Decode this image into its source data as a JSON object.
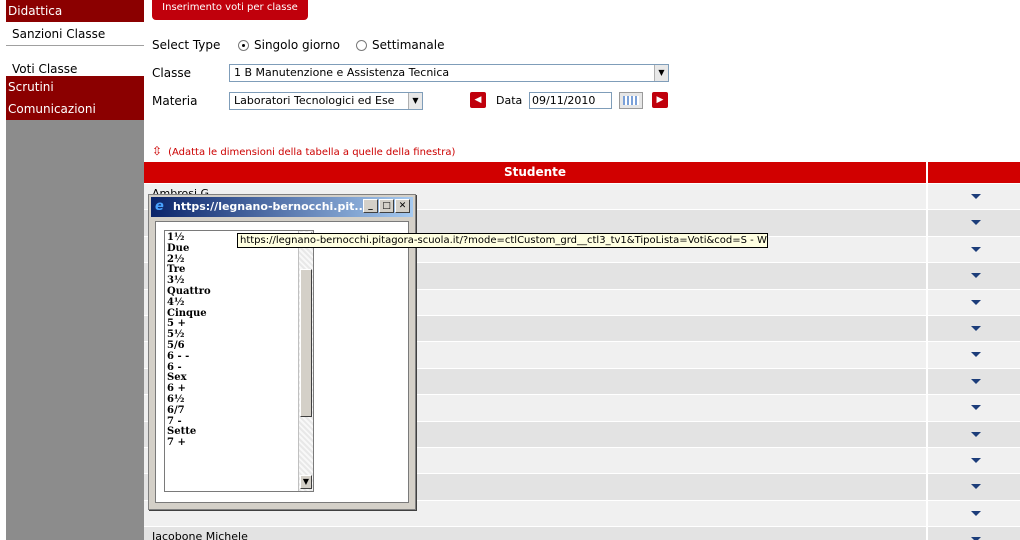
{
  "sidebar": {
    "categories": [
      "Didattica",
      "Scrutini",
      "Comunicazioni"
    ],
    "items": [
      "Sanzioni Classe",
      "Voti Classe"
    ]
  },
  "header": {
    "insert_button": "Inserimento voti per classe"
  },
  "form": {
    "select_type_label": "Select Type",
    "option_single": "Singolo giorno",
    "option_weekly": "Settimanale",
    "classe_label": "Classe",
    "classe_value": "1 B Manutenzione e Assistenza Tecnica",
    "materia_label": "Materia",
    "materia_value": "Laboratori Tecnologici ed Ese",
    "data_label": "Data",
    "data_value": "09/11/2010"
  },
  "adapt_text": "(Adatta le dimensioni della tabella a quelle della finestra)",
  "table": {
    "header": "Studente",
    "rows": [
      "Ambrosi G...",
      "",
      "",
      "",
      "",
      "",
      "",
      "",
      "",
      "",
      "",
      "",
      "",
      "Iacobone Michele"
    ]
  },
  "popup": {
    "title": "https://legnano-bernocchi.pit...",
    "grades": [
      "1½",
      "Due",
      "2½",
      "Tre",
      "3½",
      "Quattro",
      "4½",
      "Cinque",
      "5 +",
      "5½",
      "5/6",
      "6 - -",
      "6 -",
      "Sex",
      "6 +",
      "6½",
      "6/7",
      "7 -",
      "Sette",
      "7 +"
    ]
  },
  "tooltip": "https://legnano-bernocchi.pitagora-scuola.it/?mode=ctlCustom_grd__ctl3_tv1&TipoLista=Voti&cod=S - W",
  "colors": {
    "accent": "#c0000c",
    "sidebar": "#8c8c8c",
    "category": "#8b0000"
  }
}
